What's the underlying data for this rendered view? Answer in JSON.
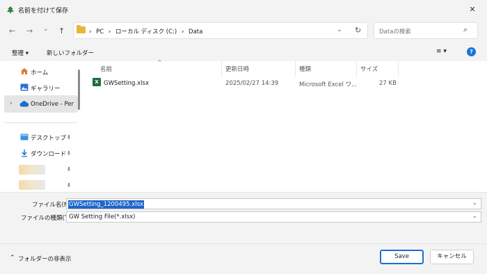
{
  "window": {
    "title": "名前を付けて保存",
    "close_glyph": "✕"
  },
  "nav": {
    "back": "←",
    "forward": "→",
    "recent": "⌄",
    "up": "↑"
  },
  "address": {
    "sep": "›",
    "segments": [
      "PC",
      "ローカル ディスク (C:)",
      "Data"
    ],
    "dropdown": "⌄",
    "refresh": "↻"
  },
  "search": {
    "placeholder": "Dataの検索",
    "icon_glyph": "⌕"
  },
  "toolbar": {
    "organize": "整理 ▾",
    "new_folder": "新しいフォルダー",
    "view_glyph": "≡ ▾",
    "help_glyph": "?"
  },
  "sidebar": {
    "items": [
      {
        "label": "ホーム",
        "icon": "home-icon"
      },
      {
        "label": "ギャラリー",
        "icon": "gallery-icon"
      },
      {
        "label": "OneDrive - Perso",
        "icon": "cloud-icon",
        "selected": true
      },
      {
        "label": "デスクトップ",
        "icon": "desktop-icon",
        "pinned": true
      },
      {
        "label": "ダウンロード",
        "icon": "download-icon",
        "pinned": true
      }
    ],
    "expand_glyph": "›",
    "pin_glyph": "📌"
  },
  "columns": {
    "name": "名前",
    "date": "更新日時",
    "type": "種類",
    "size": "サイズ",
    "sort_glyph": "^"
  },
  "files": [
    {
      "name": "GWSetting.xlsx",
      "date": "2025/02/27 14:39",
      "type": "Microsoft Excel ワ...",
      "size": "27 KB",
      "icon_glyph": "X"
    }
  ],
  "form": {
    "filename_label": "ファイル名(N):",
    "filename_value": "GWSetting_1200495.xlsx",
    "filetype_label": "ファイルの種類(T):",
    "filetype_value": "GW Setting File(*.xlsx)",
    "arrow": "⌄"
  },
  "footer": {
    "hide_folders": "フォルダーの非表示",
    "hide_glyph": "⌃",
    "save": "Save",
    "cancel": "キャンセル"
  },
  "colors": {
    "accent": "#1a6fd0",
    "selection": "#1e66c9",
    "excel": "#1d6f42",
    "folder": "#e8b73a"
  }
}
